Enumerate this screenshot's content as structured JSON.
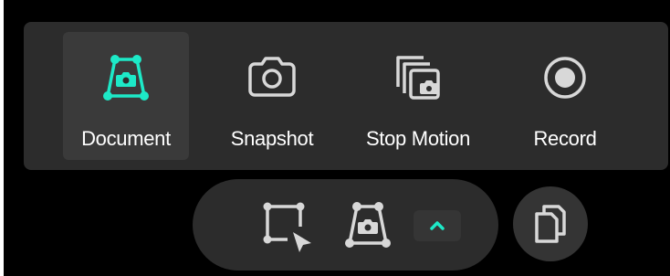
{
  "colors": {
    "accent": "#1de9c7",
    "panel": "#2c2c2c",
    "selected_tile": "#3a3a3a",
    "icon": "#d8d8d8",
    "text": "#ffffff",
    "background": "#000000"
  },
  "mode_bar": {
    "selected": "Document",
    "items": [
      {
        "label": "Document",
        "icon": "document-scan-icon",
        "selected": true
      },
      {
        "label": "Snapshot",
        "icon": "camera-icon",
        "selected": false
      },
      {
        "label": "Stop Motion",
        "icon": "stop-motion-icon",
        "selected": false
      },
      {
        "label": "Record",
        "icon": "record-icon",
        "selected": false
      }
    ]
  },
  "toolbar": {
    "tools": [
      {
        "icon": "region-select-icon"
      },
      {
        "icon": "document-scan-icon"
      },
      {
        "icon": "chevron-up-icon"
      }
    ]
  },
  "copy_button": {
    "icon": "copy-icon"
  }
}
